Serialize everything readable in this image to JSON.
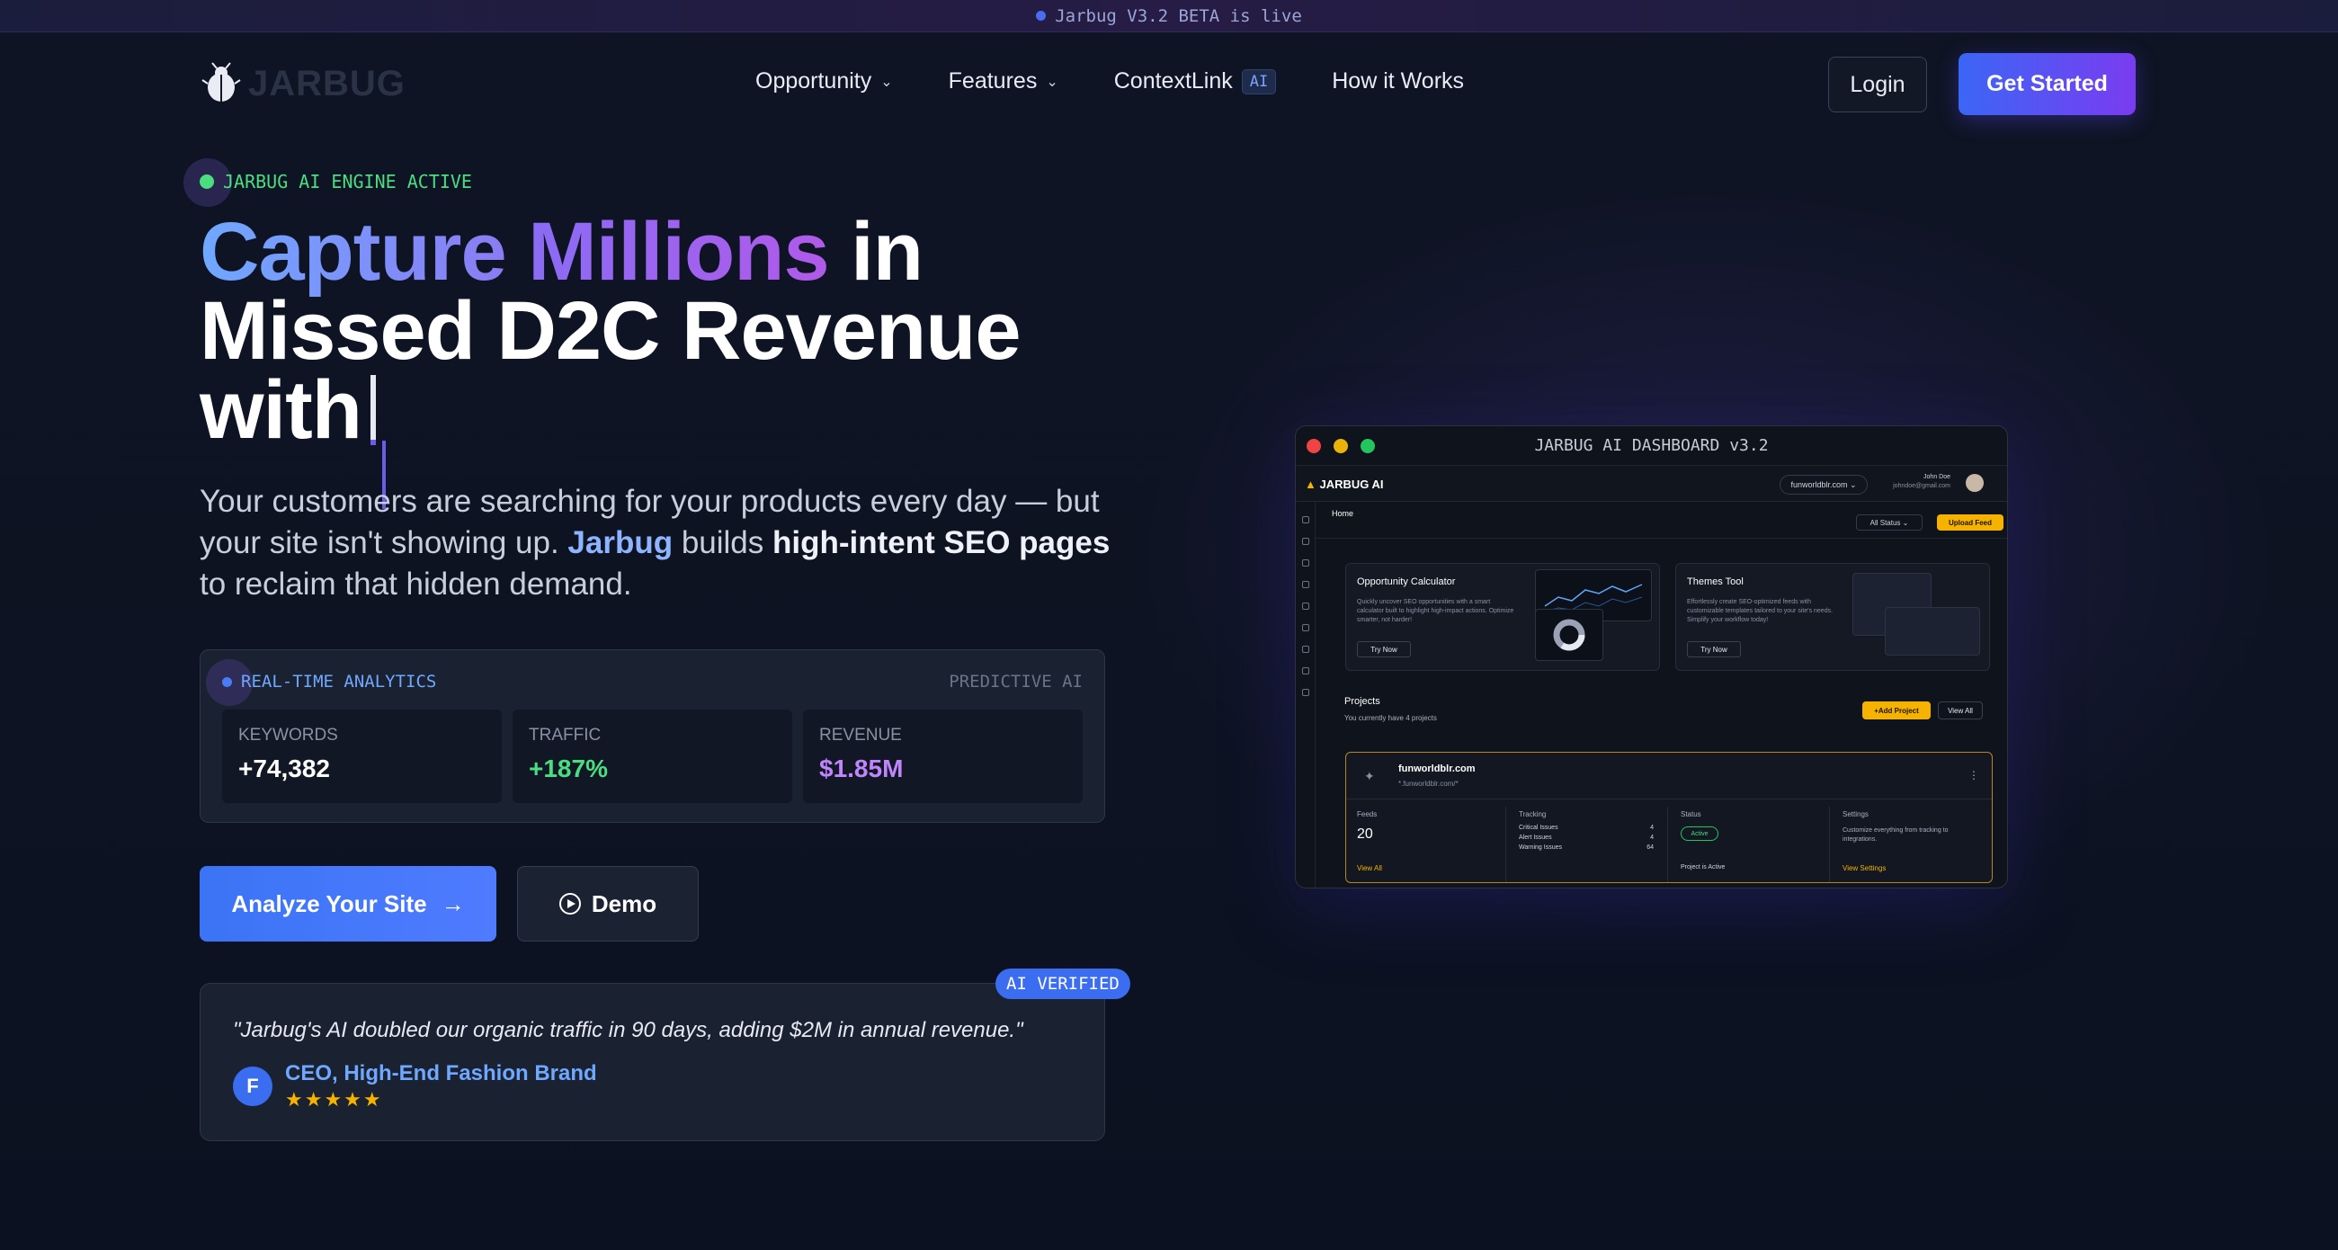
{
  "banner": {
    "text": "Jarbug V3.2 BETA is live"
  },
  "nav": {
    "logo": "JARBUG",
    "menu": [
      {
        "label": "Opportunity",
        "dropdown": true
      },
      {
        "label": "Features",
        "dropdown": true
      },
      {
        "label": "ContextLink",
        "badge": "AI"
      },
      {
        "label": "How it Works"
      }
    ],
    "login": "Login",
    "get_started": "Get Started"
  },
  "hero": {
    "engine_status": "JARBUG AI ENGINE ACTIVE",
    "headline_part1": "Capture",
    "headline_part2": "Millions",
    "headline_part3": " in",
    "headline_line2": "Missed D2C Revenue",
    "headline_line3": "with",
    "subtitle_1": "Your customers are searching for your products every day — but your site isn't showing up. ",
    "subtitle_brand": "Jarbug",
    "subtitle_2": " builds ",
    "subtitle_bold": "high-intent SEO pages",
    "subtitle_3": " to reclaim that hidden demand."
  },
  "analytics": {
    "title": "REAL-TIME ANALYTICS",
    "tag": "PREDICTIVE AI",
    "stats": [
      {
        "label": "KEYWORDS",
        "value": "+74,382",
        "color": "#ffffff"
      },
      {
        "label": "TRAFFIC",
        "value": "+187%",
        "color": "#4ade80"
      },
      {
        "label": "REVENUE",
        "value": "$1.85M",
        "color": "#c084fc"
      }
    ]
  },
  "cta": {
    "analyze": "Analyze Your Site",
    "demo": "Demo"
  },
  "testimonial": {
    "badge": "AI VERIFIED",
    "quote": "\"Jarbug's AI doubled our organic traffic in 90 days, adding $2M in annual revenue.\"",
    "avatar": "F",
    "author": "CEO, High-End Fashion Brand",
    "stars": "★★★★★"
  },
  "dashboard": {
    "title": "JARBUG AI DASHBOARD v3.2",
    "brand": "JARBUG AI",
    "site_select": "funworldblr.com",
    "user_name": "John Doe",
    "user_email": "johndoe@gmail.com",
    "breadcrumb": "Home",
    "status_filter": "All Status",
    "upload_feed": "Upload Feed",
    "cards": [
      {
        "title": "Opportunity Calculator",
        "desc": "Quickly uncover SEO opportunities with a smart calculator built to highlight high-impact actions. Optimize smarter, not harder!",
        "button": "Try Now"
      },
      {
        "title": "Themes Tool",
        "desc": "Effortlessly create SEO-optimized feeds with customizable templates tailored to your site's needs. Simplify your workflow today!",
        "button": "Try Now"
      }
    ],
    "projects_title": "Projects",
    "projects_sub": "You currently have 4 projects",
    "add_project": "Add Project",
    "view_all": "View All",
    "project": {
      "name": "funworldblr.com",
      "url": "*.funworldblr.com/*",
      "feeds_label": "Feeds",
      "feeds_count": "20",
      "feeds_link": "View All",
      "tracking_label": "Tracking",
      "tracking": [
        {
          "label": "Critical Issues",
          "value": "4"
        },
        {
          "label": "Alert Issues",
          "value": "4"
        },
        {
          "label": "Warning Issues",
          "value": "64"
        }
      ],
      "status_label": "Status",
      "status": "Active",
      "status_note": "Project is Active",
      "settings_label": "Settings",
      "settings_desc": "Customize everything from tracking to integrations.",
      "settings_link": "View Settings"
    }
  }
}
